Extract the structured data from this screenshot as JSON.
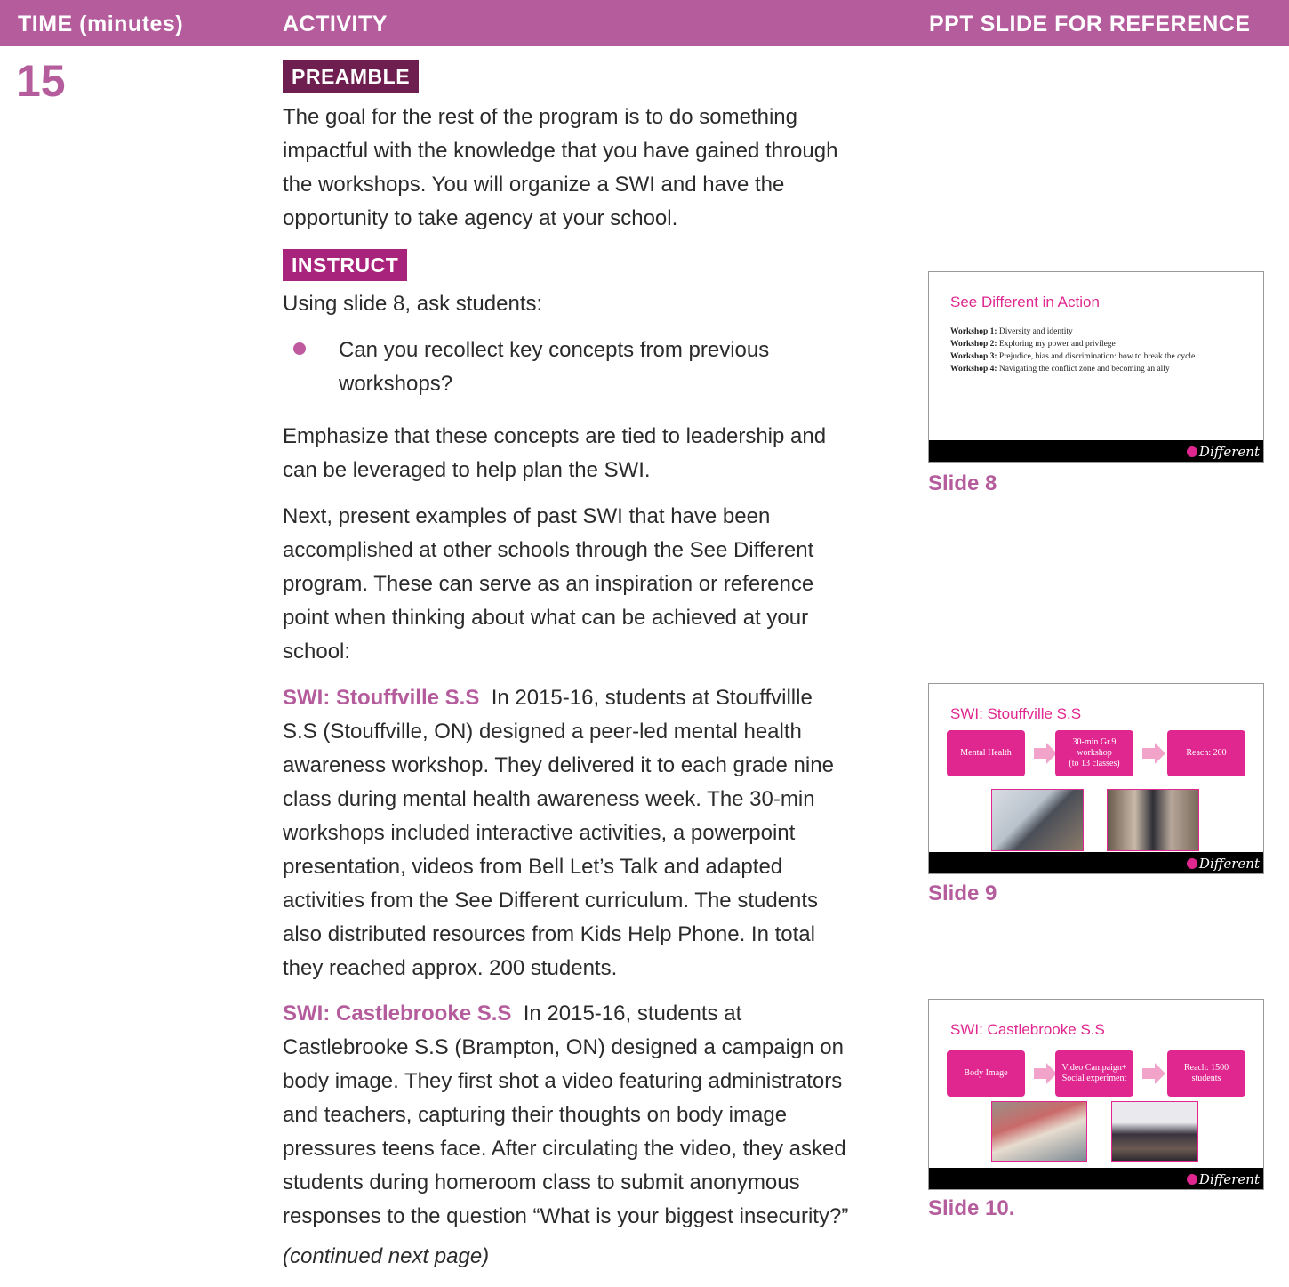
{
  "header": {
    "time": "TIME (minutes)",
    "activity": "ACTIVITY",
    "ppt": "PPT SLIDE FOR REFERENCE"
  },
  "time_value": "15",
  "preamble": {
    "label": "PREAMBLE",
    "lines": [
      "The goal for the rest of the program is to do something",
      "impactful with the knowledge that you have gained through",
      "the workshops. You will organize a SWI and have the",
      "opportunity to take agency at your school."
    ]
  },
  "instruct": {
    "label": "INSTRUCT",
    "intro": "Using slide 8, ask students:",
    "bullet_lines": [
      "Can you recollect key concepts from previous",
      "workshops?"
    ],
    "emphasize_lines": [
      "Emphasize that these concepts are tied to leadership and",
      "can be leveraged to help plan the SWI."
    ],
    "next_lines": [
      "Next, present examples of past SWI that have been",
      "accomplished at other schools through the See Different",
      "program. These can serve as an inspiration or reference",
      "point when thinking about what can be achieved at your",
      "school:"
    ]
  },
  "swi1": {
    "title": "SWI: Stouffville S.S",
    "first_line": "In 2015-16, students at Stouffvillle",
    "lines": [
      "S.S (Stouffville, ON) designed a peer-led mental health",
      "awareness workshop. They delivered it to each grade nine",
      "class during mental health awareness week. The 30-min",
      "workshops included interactive activities, a powerpoint",
      "presentation, videos from Bell Let’s Talk and adapted",
      "activities from the See Different curriculum. The students",
      "also distributed resources from Kids Help Phone. In total",
      "they reached approx. 200 students."
    ]
  },
  "swi2": {
    "title": "SWI: Castlebrooke S.S",
    "first_line": "In 2015-16, students at",
    "lines": [
      "Castlebrooke S.S (Brampton, ON) designed a campaign on",
      "body image. They first shot a video featuring administrators",
      "and teachers, capturing their thoughts on body image",
      "pressures teens face. After circulating the video, they asked",
      "students during homeroom class to submit anonymous",
      "responses to the question “What is your biggest insecurity?”"
    ]
  },
  "continued": "(continued next page)",
  "slides": {
    "s8": {
      "title": "See Different in Action",
      "items": [
        {
          "k": "Workshop 1:",
          "v": "Diversity and identity"
        },
        {
          "k": "Workshop 2:",
          "v": "Exploring my power and privilege"
        },
        {
          "k": "Workshop 3:",
          "v": "Prejudice, bias and discrimination: how to break the cycle"
        },
        {
          "k": "Workshop 4:",
          "v": "Navigating the conflict zone and becoming an ally"
        }
      ],
      "caption": "Slide 8"
    },
    "s9": {
      "title": "SWI: Stouffville S.S",
      "box1": "Mental Health",
      "box2a": "30-min Gr.9 workshop",
      "box2b": "(to 13 classes)",
      "box3": "Reach: 200",
      "caption": "Slide 9"
    },
    "s10": {
      "title": "SWI: Castlebrooke S.S",
      "box1": "Body Image",
      "box2": "Video Campaign+ Social experiment",
      "box3": "Reach: 1500 students",
      "caption": "Slide 10."
    },
    "logo": "Different"
  },
  "colors": {
    "header": "#b45c9c",
    "preamble": "#6e1e4f",
    "instruct": "#a8247c",
    "slide_accent": "#e0278f"
  }
}
